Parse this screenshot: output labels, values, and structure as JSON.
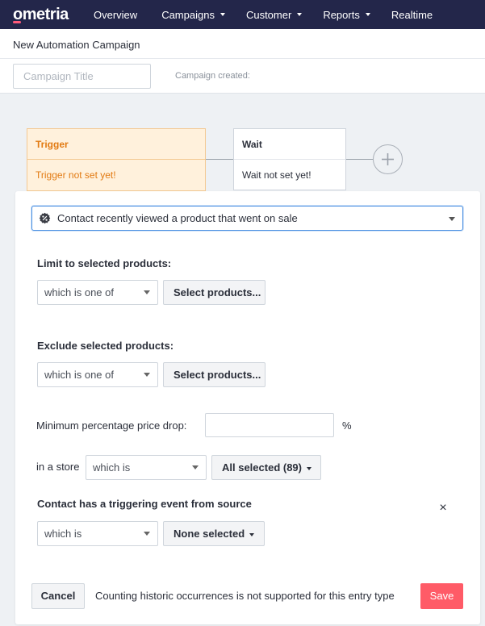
{
  "nav": {
    "logo": "ometria",
    "items": [
      {
        "label": "Overview",
        "has_caret": false
      },
      {
        "label": "Campaigns",
        "has_caret": true
      },
      {
        "label": "Customer",
        "has_caret": true
      },
      {
        "label": "Reports",
        "has_caret": true
      },
      {
        "label": "Realtime",
        "has_caret": false
      }
    ]
  },
  "header": {
    "title": "New Automation Campaign",
    "title_input_placeholder": "Campaign Title",
    "created_label": "Campaign created:"
  },
  "flow": {
    "trigger": {
      "title": "Trigger",
      "status": "Trigger not set yet!"
    },
    "wait": {
      "title": "Wait",
      "status": "Wait not set yet!"
    },
    "add_icon": "plus-circle-icon"
  },
  "panel": {
    "trigger_type": "Contact recently viewed a product that went on sale",
    "limit": {
      "label": "Limit to selected products:",
      "operator": "which is one of",
      "button": "Select products..."
    },
    "exclude": {
      "label": "Exclude selected products:",
      "operator": "which is one of",
      "button": "Select products..."
    },
    "price_drop": {
      "label": "Minimum percentage price drop:",
      "value": "",
      "unit": "%"
    },
    "store": {
      "label": "in a store",
      "operator": "which is",
      "selection": "All selected (89)"
    },
    "source": {
      "label": "Contact has a triggering event from source",
      "operator": "which is",
      "selection": "None selected",
      "close": "×"
    }
  },
  "footer": {
    "cancel": "Cancel",
    "note": "Counting historic occurrences is not supported for this entry type",
    "save": "Save"
  },
  "colors": {
    "nav_bg": "#23264a",
    "trigger_bg": "#fff1dc",
    "trigger_text": "#e27a12",
    "save_bg": "#ff5b67",
    "focus_border": "#4a90e2"
  }
}
